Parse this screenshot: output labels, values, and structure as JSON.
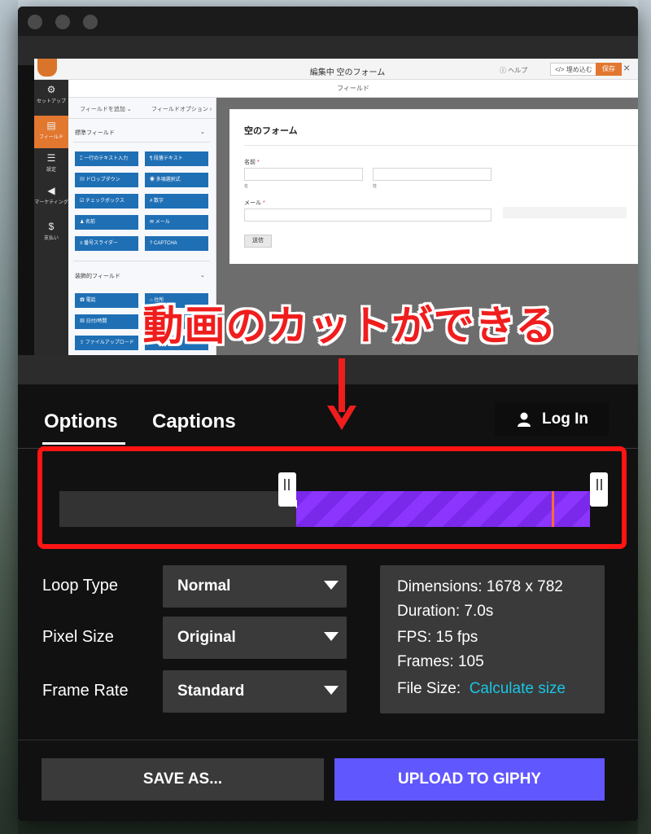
{
  "preview": {
    "app_title": "編集中 空のフォーム",
    "help": "ヘルプ",
    "embed": "</> 埋め込む",
    "save": "保存",
    "close": "×",
    "subheader": "フィールド",
    "sidebar": [
      {
        "label": "セットアップ",
        "icon": "gear-icon"
      },
      {
        "label": "フィールド",
        "icon": "fields-icon"
      },
      {
        "label": "設定",
        "icon": "sliders-icon"
      },
      {
        "label": "マーケティング",
        "icon": "megaphone-icon"
      },
      {
        "label": "支払い",
        "icon": "dollar-icon"
      }
    ],
    "panel_tabs": [
      "フィールドを追加 ⌄",
      "フィールドオプション ›"
    ],
    "standard_heading": "標準フィールド",
    "standard_fields": [
      "一行のテキスト入力",
      "段落テキスト",
      "ドロップダウン",
      "多項選択式",
      "チェックボックス",
      "数字",
      "名前",
      "メール",
      "番号スライダー",
      "CAPTCHA"
    ],
    "fancy_heading": "装飾的フィールド",
    "fancy_fields": [
      "電話",
      "住所",
      "日付/時間",
      "ウェブサイト/URL",
      "ファイルアップロード",
      "パスワード"
    ],
    "form": {
      "title": "空のフォーム",
      "name_label": "名前",
      "first_sub": "名",
      "last_sub": "姓",
      "email_label": "メール",
      "submit": "送信"
    }
  },
  "overlay_caption": "動画のカットができる",
  "tabs": [
    "Options",
    "Captions"
  ],
  "login_label": "Log In",
  "trim": {
    "start_fraction": 0.447,
    "end_fraction": 1.0,
    "playhead_fraction": 0.928
  },
  "options": [
    {
      "label": "Loop Type",
      "value": "Normal"
    },
    {
      "label": "Pixel Size",
      "value": "Original"
    },
    {
      "label": "Frame Rate",
      "value": "Standard"
    }
  ],
  "info": {
    "dimensions_label": "Dimensions:",
    "dimensions": "1678 x 782",
    "duration_label": "Duration:",
    "duration": "7.0s",
    "fps_label": "FPS:",
    "fps": "15 fps",
    "frames_label": "Frames:",
    "frames": "105",
    "filesize_label": "File Size:",
    "filesize_link": "Calculate size"
  },
  "buttons": {
    "save_as": "SAVE AS...",
    "upload": "UPLOAD TO GIPHY"
  },
  "colors": {
    "accent_purple": "#6157ff",
    "selection": "#8b35ff",
    "highlight_red": "#ff1414",
    "link": "#19c5e6"
  }
}
